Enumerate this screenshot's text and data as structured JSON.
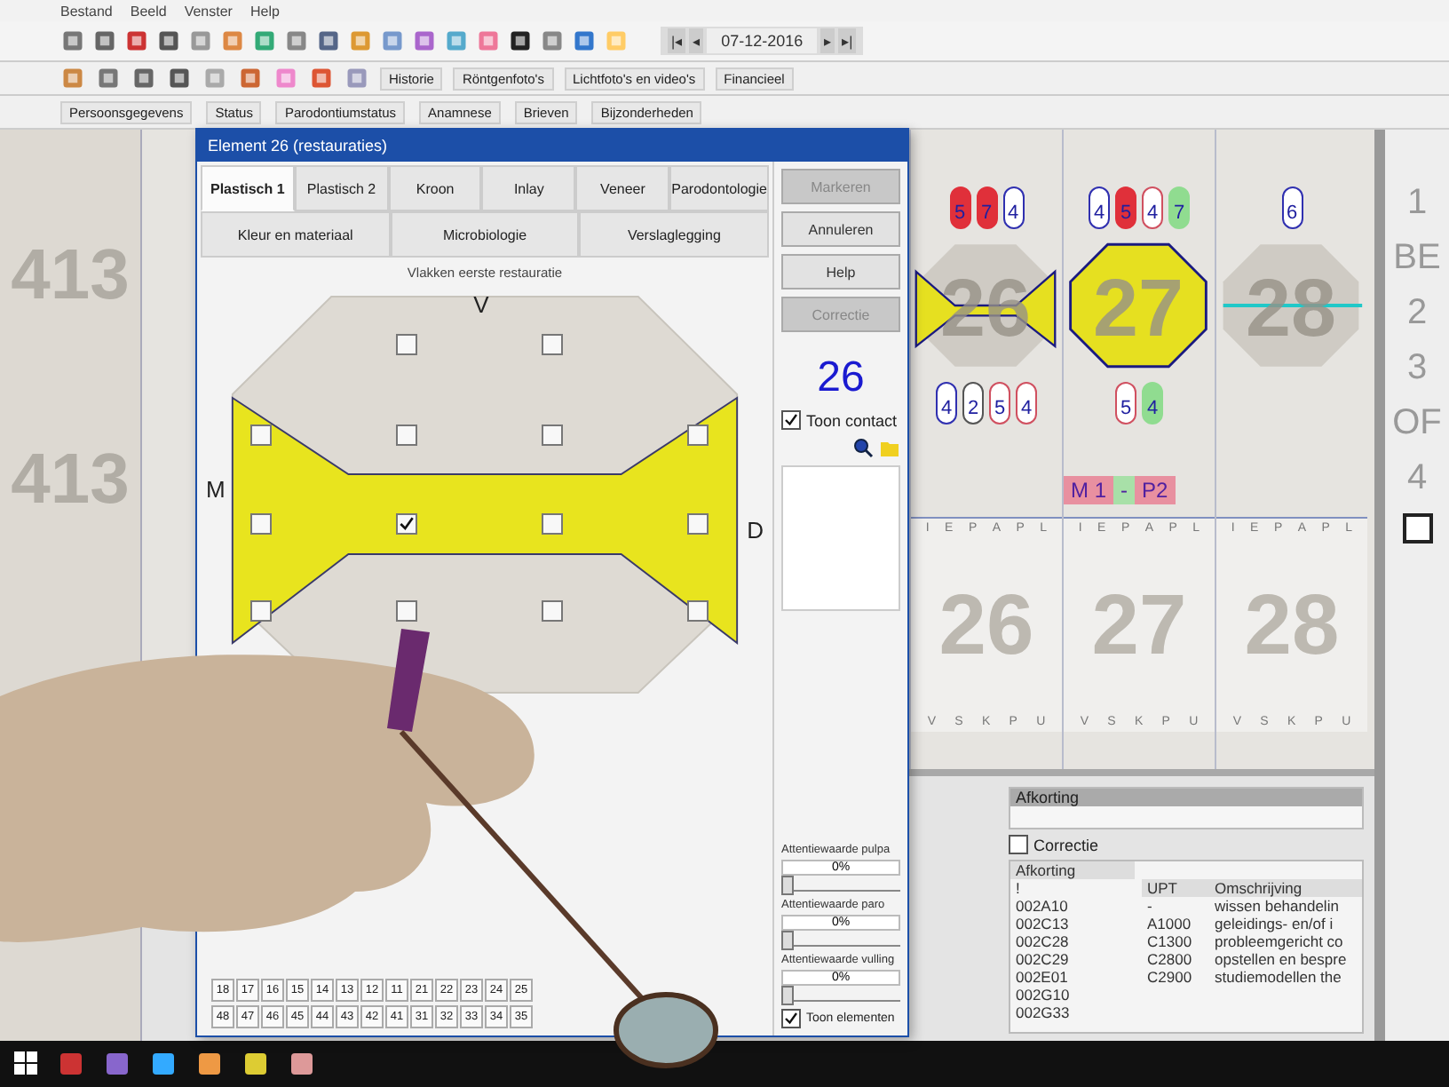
{
  "menu": [
    "Bestand",
    "Beeld",
    "Venster",
    "Help"
  ],
  "toolbar": {
    "nav_before": [
      "|◂",
      "◂"
    ],
    "date": "07-12-2016",
    "nav_after": [
      "▸",
      "▸|"
    ]
  },
  "toolbar_row2": [
    {
      "label": "Historie"
    },
    {
      "label": "Röntgenfoto's"
    },
    {
      "label": "Lichtfoto's en video's"
    },
    {
      "label": "Financieel"
    }
  ],
  "toolbar_row3": [
    {
      "label": "Persoonsgegevens"
    },
    {
      "label": "Status"
    },
    {
      "label": "Parodontiumstatus"
    },
    {
      "label": "Anamnese"
    },
    {
      "label": "Brieven"
    },
    {
      "label": "Bijzonderheden"
    }
  ],
  "left_strip": [
    "413",
    "413"
  ],
  "chart": {
    "teeth": [
      {
        "number": "26",
        "kind": "bowtie",
        "upper_pills": [
          {
            "value": "5",
            "color": "#e0303a",
            "filled": true
          },
          {
            "value": "7",
            "color": "#e0303a",
            "filled": true
          },
          {
            "value": "4",
            "color": "#3030b0",
            "filled": false
          }
        ],
        "lower_pills": [
          {
            "value": "4",
            "color": "#3030b0",
            "filled": false
          },
          {
            "value": "2",
            "color": "#555555",
            "filled": false
          },
          {
            "value": "5",
            "color": "#d05060",
            "filled": false
          },
          {
            "value": "4",
            "color": "#d05060",
            "filled": false
          }
        ],
        "top_letters": [
          "I",
          "E",
          "P",
          "A",
          "P",
          "L"
        ],
        "number_lower": "26",
        "bottom_letters": [
          "V",
          "S",
          "K",
          "P",
          "U"
        ]
      },
      {
        "number": "27",
        "kind": "full",
        "upper_pills": [
          {
            "value": "4",
            "color": "#3030b0",
            "filled": false
          },
          {
            "value": "5",
            "color": "#e0303a",
            "filled": true
          },
          {
            "value": "4",
            "color": "#d05060",
            "filled": false
          },
          {
            "value": "7",
            "color": "#90dc90",
            "filled": true
          }
        ],
        "lower_pills": [
          {
            "value": "5",
            "color": "#d05060",
            "filled": false
          },
          {
            "value": "4",
            "color": "#90dc90",
            "filled": true
          }
        ],
        "top_letters": [
          "I",
          "E",
          "P",
          "A",
          "P",
          "L"
        ],
        "number_lower": "27",
        "bottom_letters": [
          "V",
          "S",
          "K",
          "P",
          "U"
        ]
      },
      {
        "number": "28",
        "kind": "line",
        "upper_pills": [
          {
            "value": "6",
            "color": "#3030b0",
            "filled": false
          }
        ],
        "top_letters": [
          "I",
          "E",
          "P",
          "A",
          "P",
          "L"
        ],
        "number_lower": "28",
        "bottom_letters": [
          "V",
          "S",
          "K",
          "P",
          "U"
        ]
      }
    ],
    "mobility": [
      {
        "text": "M 1",
        "color": "#e890a0"
      },
      {
        "text": "-",
        "color": "#a8e0a8"
      },
      {
        "text": "P2",
        "color": "#e890a0"
      }
    ]
  },
  "right_column": {
    "labels": [
      "1",
      "BE",
      "2",
      "3",
      "OF",
      "4"
    ],
    "checkbox": {
      "checked": false
    }
  },
  "dialog": {
    "title": "Element 26 (restauraties)",
    "tabs": [
      {
        "label": "Plastisch 1",
        "selected": true
      },
      {
        "label": "Plastisch 2",
        "selected": false
      },
      {
        "label": "Kroon",
        "selected": false
      },
      {
        "label": "Inlay",
        "selected": false
      },
      {
        "label": "Veneer",
        "selected": false
      },
      {
        "label": "Parodontologie",
        "selected": false
      }
    ],
    "tabs_row2": [
      {
        "label": "Kleur en materiaal",
        "selected": false
      },
      {
        "label": "Microbiologie",
        "selected": false
      },
      {
        "label": "Verslaglegging",
        "selected": false
      }
    ],
    "surface_heading": "Vlakken eerste restauratie",
    "surface_labels": {
      "top": "V",
      "left": "M",
      "right": "D"
    },
    "surface_checkboxes": [
      [
        false,
        false
      ],
      [
        false,
        false,
        false,
        false
      ],
      [
        false,
        true,
        false,
        false
      ],
      [
        false,
        false,
        false,
        false
      ]
    ],
    "tooth_buttons_upper": [
      "18",
      "17",
      "16",
      "15",
      "14",
      "13",
      "12",
      "11",
      "21",
      "22",
      "23",
      "24",
      "25"
    ],
    "tooth_buttons_lower": [
      "48",
      "47",
      "46",
      "45",
      "44",
      "43",
      "42",
      "41",
      "31",
      "32",
      "33",
      "34",
      "35"
    ],
    "buttons": [
      {
        "label": "Markeren",
        "disabled": true
      },
      {
        "label": "Annuleren",
        "disabled": false
      },
      {
        "label": "Help",
        "disabled": false
      },
      {
        "label": "Correctie",
        "disabled": true
      }
    ],
    "element_number": "26",
    "toon_contact": {
      "label": "Toon contact",
      "checked": true
    },
    "attention": [
      {
        "label": "Attentiewaarde pulpa",
        "value": "0%",
        "level": 0
      },
      {
        "label": "Attentiewaarde paro",
        "value": "0%",
        "level": 0
      },
      {
        "label": "Attentiewaarde vulling",
        "value": "0%",
        "level": 0
      }
    ],
    "toon_elementen": {
      "label": "Toon elementen",
      "checked": true
    }
  },
  "bottom": {
    "afkorting_field": {
      "label": "Afkorting"
    },
    "correctie": {
      "label": "Correctie",
      "checked": false
    },
    "code_list": {
      "header": "Afkorting",
      "rows": [
        "!",
        "002A10",
        "002C13",
        "002C28",
        "002C29",
        "002E01",
        "002G10",
        "002G33"
      ]
    },
    "upt_table": {
      "columns": [
        "UPT",
        "Omschrijving"
      ],
      "rows": [
        [
          "-",
          "wissen behandelin"
        ],
        [
          "A1000",
          "geleidings- en/of i"
        ],
        [
          "C1300",
          "probleemgericht co"
        ],
        [
          "C2800",
          "opstellen en bespre"
        ],
        [
          "C2900",
          "studiemodellen the"
        ]
      ]
    }
  }
}
